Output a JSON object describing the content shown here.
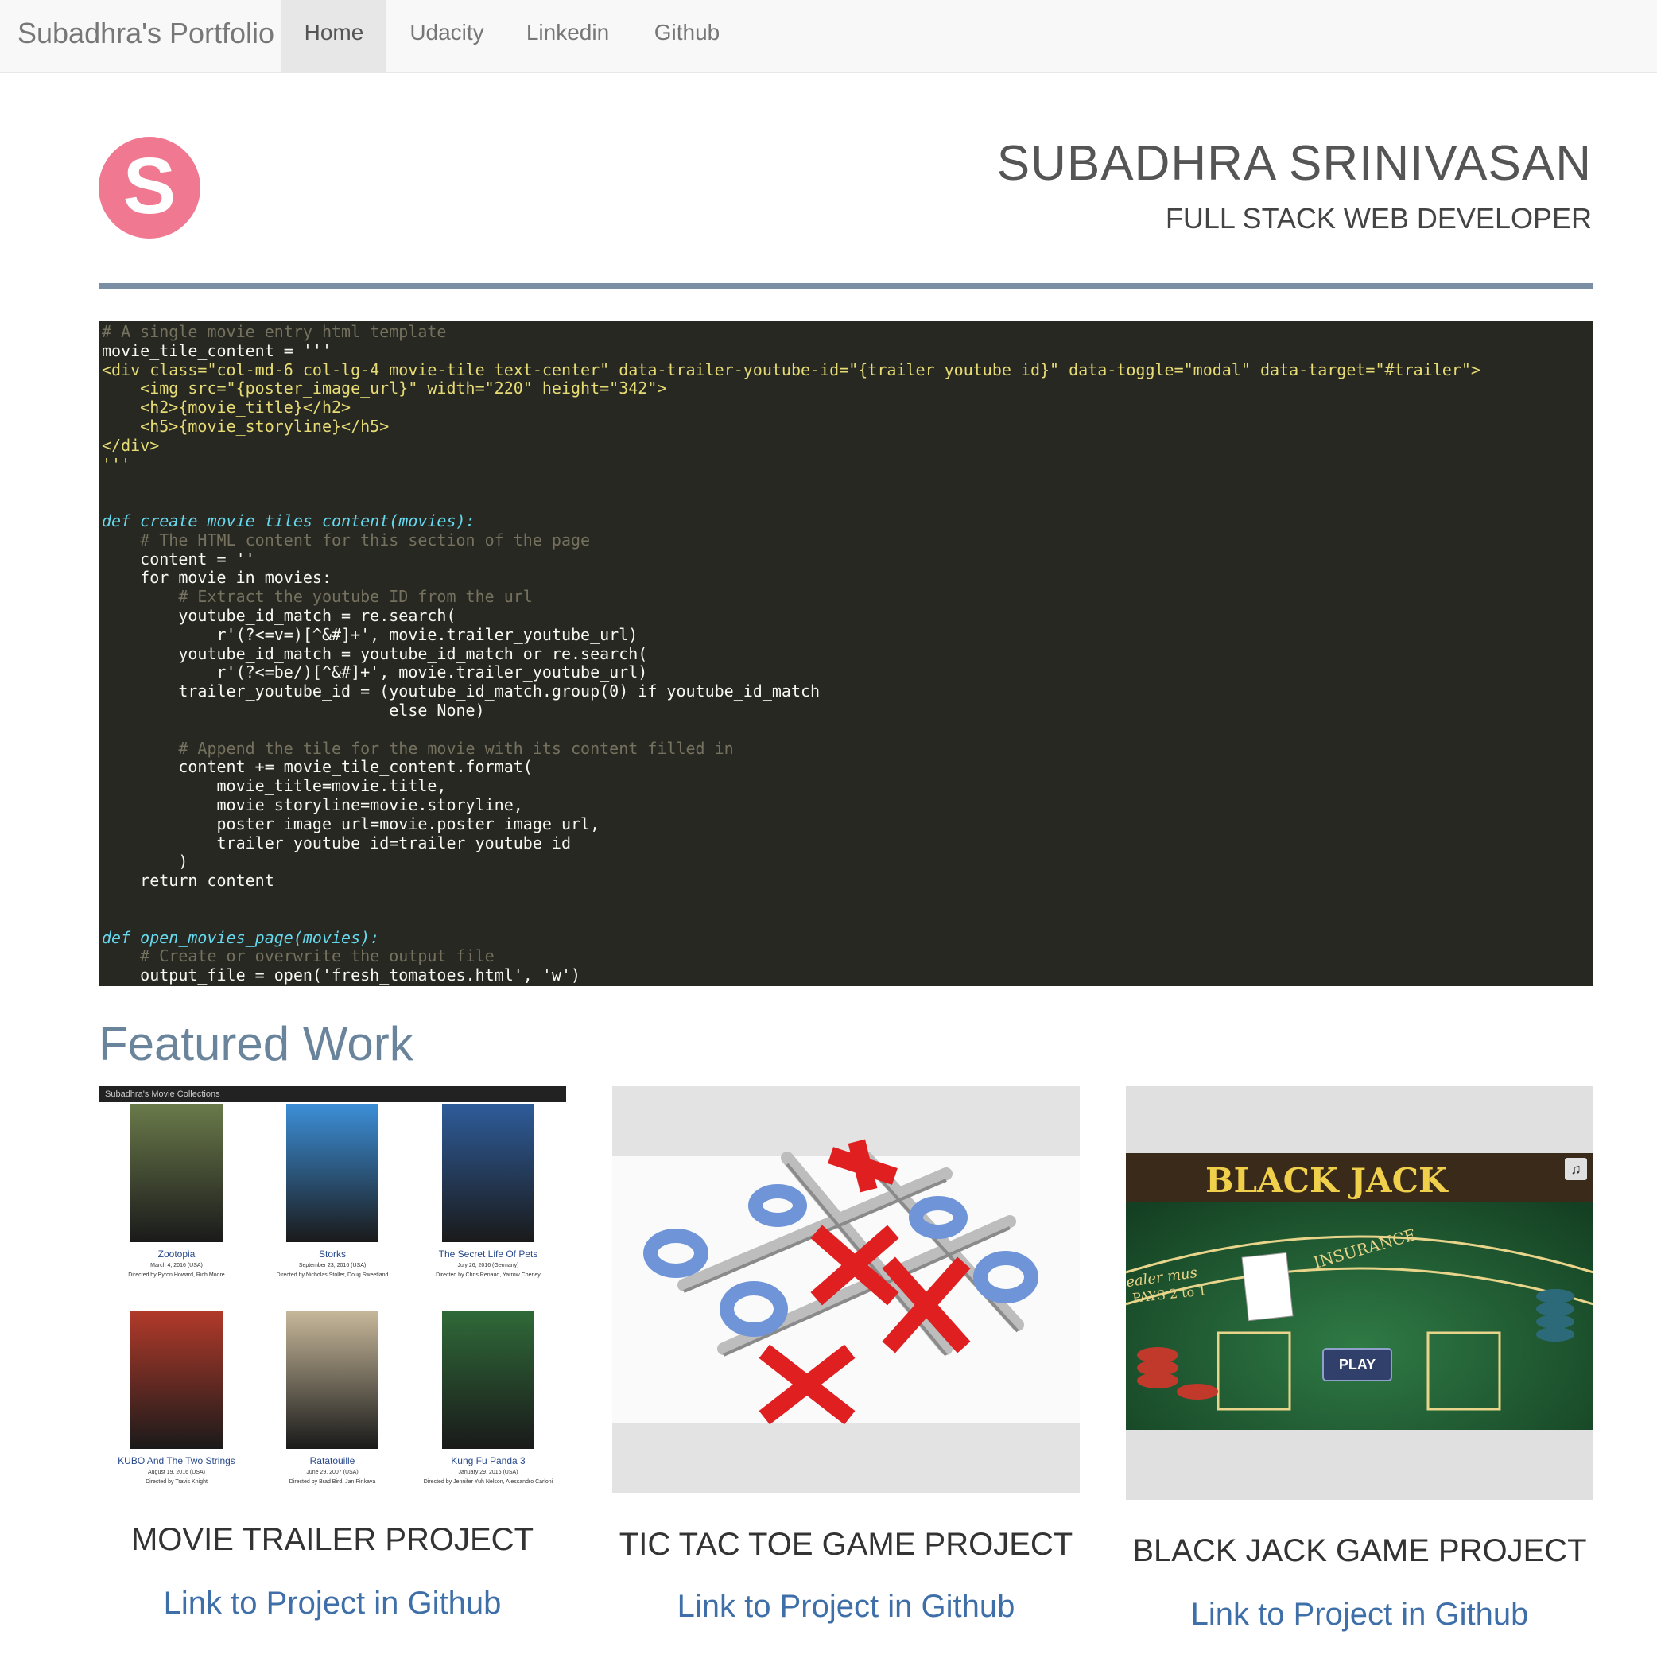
{
  "nav": {
    "brand": "Subadhra's Portfolio",
    "items": [
      "Home",
      "Udacity",
      "Linkedin",
      "Github"
    ],
    "active": "Home"
  },
  "header": {
    "avatar_letter": "S",
    "name": "SUBADHRA SRINIVASAN",
    "role": "FULL STACK WEB DEVELOPER"
  },
  "code_lines": [
    "# A single movie entry html template",
    "movie_tile_content = '''",
    "<div class=\"col-md-6 col-lg-4 movie-tile text-center\" data-trailer-youtube-id=\"{trailer_youtube_id}\" data-toggle=\"modal\" data-target=\"#trailer\">",
    "    <img src=\"{poster_image_url}\" width=\"220\" height=\"342\">",
    "    <h2>{movie_title}</h2>",
    "    <h5>{movie_storyline}</h5>",
    "</div>",
    "'''",
    "",
    "",
    "def create_movie_tiles_content(movies):",
    "    # The HTML content for this section of the page",
    "    content = ''",
    "    for movie in movies:",
    "        # Extract the youtube ID from the url",
    "        youtube_id_match = re.search(",
    "            r'(?<=v=)[^&#]+', movie.trailer_youtube_url)",
    "        youtube_id_match = youtube_id_match or re.search(",
    "            r'(?<=be/)[^&#]+', movie.trailer_youtube_url)",
    "        trailer_youtube_id = (youtube_id_match.group(0) if youtube_id_match",
    "                              else None)",
    "",
    "        # Append the tile for the movie with its content filled in",
    "        content += movie_tile_content.format(",
    "            movie_title=movie.title,",
    "            movie_storyline=movie.storyline,",
    "            poster_image_url=movie.poster_image_url,",
    "            trailer_youtube_id=trailer_youtube_id",
    "        )",
    "    return content",
    "",
    "",
    "def open_movies_page(movies):",
    "    # Create or overwrite the output file",
    "    output_file = open('fresh_tomatoes.html', 'w')"
  ],
  "code_line_styles": [
    "cmt",
    "",
    "str",
    "str",
    "str",
    "str",
    "str",
    "str",
    "",
    "",
    "def",
    "cmt",
    "",
    "",
    "cmt",
    "",
    "",
    "",
    "",
    "",
    "",
    "",
    "cmt",
    "",
    "",
    "",
    "",
    "",
    "",
    "",
    "",
    "",
    "def",
    "cmt",
    ""
  ],
  "featured": {
    "title": "Featured Work",
    "projects": [
      {
        "title": "MOVIE TRAILER PROJECT",
        "link": "Link to Project in Github"
      },
      {
        "title": "TIC TAC TOE GAME PROJECT",
        "link": "Link to Project in Github"
      },
      {
        "title": "BLACK JACK GAME PROJECT",
        "link": "Link to Project in Github"
      }
    ]
  },
  "movie_thumb": {
    "bar": "Subadhra's Movie Collections",
    "movies": [
      {
        "title": "Zootopia",
        "date": "March 4, 2016 (USA)",
        "dir": "Directed by Byron Howard, Rich Moore"
      },
      {
        "title": "Storks",
        "date": "September 23, 2016 (USA)",
        "dir": "Directed by Nicholas Stoller, Doug Sweetland"
      },
      {
        "title": "The Secret Life Of Pets",
        "date": "July 26, 2016 (Germany)",
        "dir": "Directed by Chris Renaud, Yarrow Cheney"
      },
      {
        "title": "KUBO And The Two Strings",
        "date": "August 19, 2016 (USA)",
        "dir": "Directed by Travis Knight"
      },
      {
        "title": "Ratatouille",
        "date": "June 29, 2007 (USA)",
        "dir": "Directed by Brad Bird, Jan Pinkava"
      },
      {
        "title": "Kung Fu Panda 3",
        "date": "January 29, 2016 (USA)",
        "dir": "Directed by Jennifer Yuh Nelson, Alessandro Carloni"
      }
    ],
    "poster_colors": [
      "#6a7a4a",
      "#3c8fd8",
      "#2e5c9a",
      "#b23a2a",
      "#c7b89a",
      "#2f6a38"
    ]
  },
  "blackjack_thumb": {
    "logo": "BLACK JACK",
    "play": "PLAY",
    "insurance": "INSURANCE",
    "pays": "PAYS 2 to 1",
    "dealer": "ealer mus"
  },
  "colors": {
    "accent": "#6a849c",
    "link": "#3f6fa8",
    "avatar": "#f07891",
    "code_bg": "#272822"
  }
}
